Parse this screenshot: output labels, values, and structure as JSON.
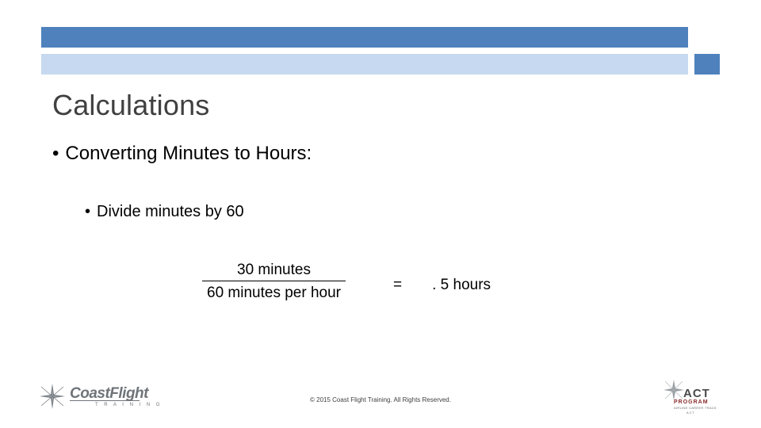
{
  "slide": {
    "title": "Calculations",
    "bullets": [
      {
        "marker": "•",
        "text": "Converting Minutes to Hours:",
        "level": 1
      },
      {
        "marker": "•",
        "text": "Divide minutes by 60",
        "level": 2
      }
    ],
    "equation": {
      "numerator": "30 minutes",
      "denominator": "60 minutes per hour",
      "equals": "=",
      "result": ". 5 hours"
    },
    "footer": "© 2015 Coast Flight Training. All Rights Reserved.",
    "logos": {
      "left": {
        "name": "CoastFlight",
        "tagline": "T R A I N I N G",
        "icon": "star-icon"
      },
      "right": {
        "name": "ACT",
        "line1": "PROGRAM",
        "line2": "AIRLINE CAREER TRACK",
        "line3": "ACT",
        "icon": "star-icon"
      }
    },
    "colors": {
      "bar_primary": "#4f81bd",
      "bar_secondary": "#c6d9f0",
      "title": "#404040",
      "body_text": "#000000",
      "footer_text": "#3f3f3f"
    }
  }
}
